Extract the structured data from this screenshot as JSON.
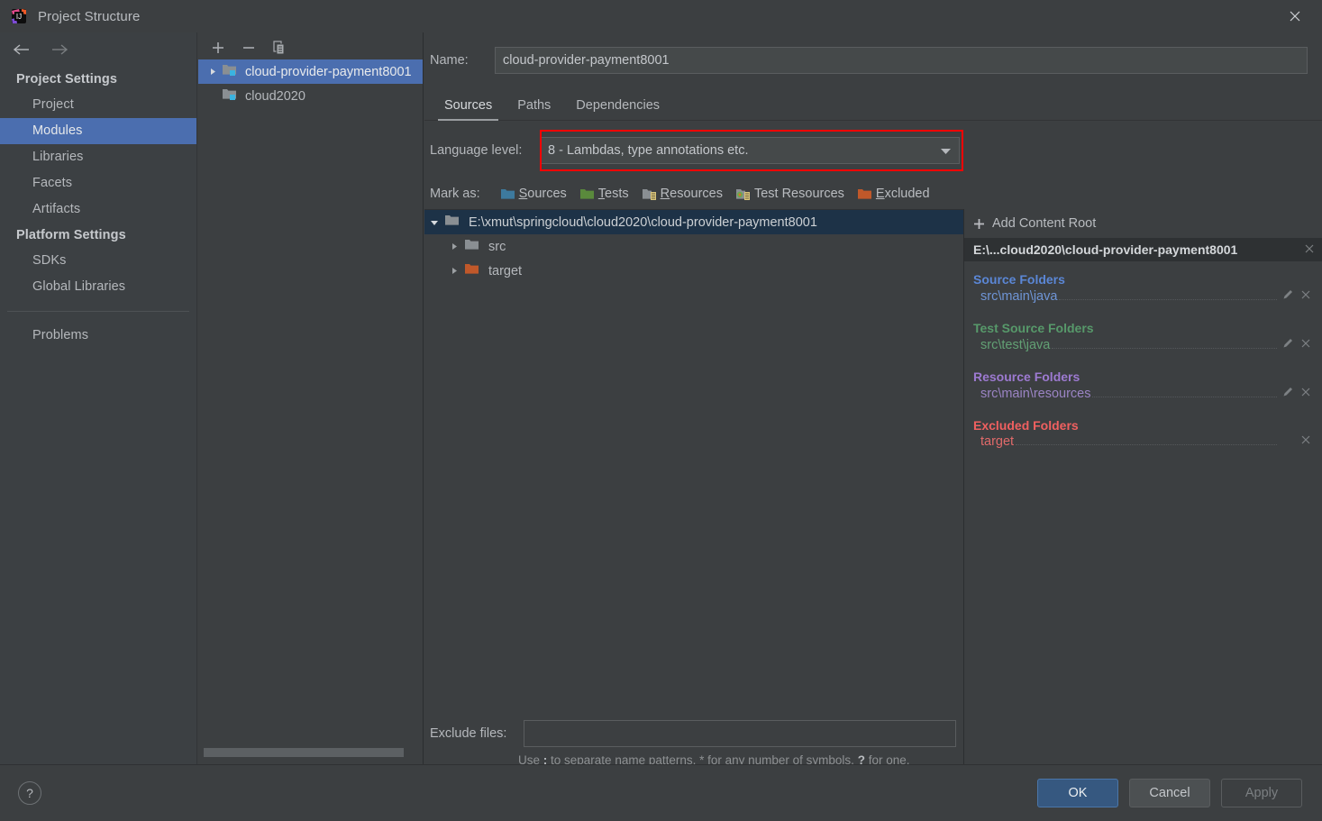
{
  "window": {
    "title": "Project Structure",
    "app_icon": "intellij-idea-icon",
    "close_icon": "close-icon"
  },
  "sidebar": {
    "back_icon": "back-arrow-icon",
    "forward_icon": "forward-arrow-icon",
    "groups": [
      {
        "label": "Project Settings",
        "items": [
          {
            "label": "Project",
            "selected": false
          },
          {
            "label": "Modules",
            "selected": true
          },
          {
            "label": "Libraries",
            "selected": false
          },
          {
            "label": "Facets",
            "selected": false
          },
          {
            "label": "Artifacts",
            "selected": false
          }
        ]
      },
      {
        "label": "Platform Settings",
        "items": [
          {
            "label": "SDKs",
            "selected": false
          },
          {
            "label": "Global Libraries",
            "selected": false
          }
        ]
      }
    ],
    "extra_items": [
      {
        "label": "Problems",
        "selected": false
      }
    ]
  },
  "module_list": {
    "toolbar": {
      "add_icon": "plus-icon",
      "remove_icon": "minus-icon",
      "copy_icon": "copy-icon"
    },
    "modules": [
      {
        "label": "cloud-provider-payment8001",
        "selected": true,
        "expandable": true
      },
      {
        "label": "cloud2020",
        "selected": false,
        "expandable": false
      }
    ]
  },
  "detail": {
    "name_label": "Name:",
    "name_value": "cloud-provider-payment8001",
    "name_placeholder": "",
    "tabs": [
      {
        "label": "Sources",
        "active": true
      },
      {
        "label": "Paths",
        "active": false
      },
      {
        "label": "Dependencies",
        "active": false
      }
    ],
    "language_level": {
      "label": "Language level:",
      "value": "8 - Lambdas, type annotations etc.",
      "dropdown_icon": "chevron-down-icon",
      "highlighted": true,
      "highlight_color": "#fe0000"
    },
    "mark_as": {
      "label": "Mark as:",
      "options": [
        {
          "label": "Sources",
          "mnemonic": "S",
          "color": "#3d7a9e",
          "icon": "folder-sources-icon"
        },
        {
          "label": "Tests",
          "mnemonic": "T",
          "color": "#5a8a3c",
          "icon": "folder-tests-icon"
        },
        {
          "label": "Resources",
          "mnemonic": "R",
          "color": "#8a8f93",
          "icon": "folder-resources-icon"
        },
        {
          "label": "Test Resources",
          "mnemonic": "",
          "color": "#8a8f93",
          "icon": "folder-test-resources-icon"
        },
        {
          "label": "Excluded",
          "mnemonic": "E",
          "color": "#c0582a",
          "icon": "folder-excluded-icon"
        }
      ]
    },
    "content_tree": [
      {
        "label": "E:\\xmut\\springcloud\\cloud2020\\cloud-provider-payment8001",
        "depth": 0,
        "expanded": true,
        "selected": true,
        "color": "#8a8f93"
      },
      {
        "label": "src",
        "depth": 1,
        "expanded": false,
        "selected": false,
        "color": "#8a8f93"
      },
      {
        "label": "target",
        "depth": 1,
        "expanded": false,
        "selected": false,
        "color": "#c0582a"
      }
    ],
    "exclude_files": {
      "label": "Exclude files:",
      "value": "",
      "placeholder": "",
      "hint_prefix": "Use ",
      "hint_semicolon": ";",
      "hint_middle": " to separate name patterns, * for any number of symbols, ",
      "hint_question": "?",
      "hint_suffix": " for one."
    }
  },
  "roots_panel": {
    "add_content_root": "Add Content Root",
    "add_icon": "plus-icon",
    "root_header": "E:\\...cloud2020\\cloud-provider-payment8001",
    "root_close_icon": "close-icon",
    "groups": [
      {
        "title": "Source Folders",
        "kind": "src",
        "color": "#5b87d6",
        "folders": [
          {
            "path": "src\\main\\java",
            "has_edit": true,
            "has_remove": true
          }
        ]
      },
      {
        "title": "Test Source Folders",
        "kind": "test",
        "color": "#57996a",
        "folders": [
          {
            "path": "src\\test\\java",
            "has_edit": true,
            "has_remove": true
          }
        ]
      },
      {
        "title": "Resource Folders",
        "kind": "res",
        "color": "#9d7ad1",
        "folders": [
          {
            "path": "src\\main\\resources",
            "has_edit": true,
            "has_remove": true
          }
        ]
      },
      {
        "title": "Excluded Folders",
        "kind": "exc",
        "color": "#f06060",
        "folders": [
          {
            "path": "target",
            "has_edit": false,
            "has_remove": true
          }
        ]
      }
    ]
  },
  "bottom_bar": {
    "help_label": "?",
    "buttons": [
      {
        "label": "OK",
        "style": "primary"
      },
      {
        "label": "Cancel",
        "style": "normal"
      },
      {
        "label": "Apply",
        "style": "disabled"
      }
    ]
  }
}
